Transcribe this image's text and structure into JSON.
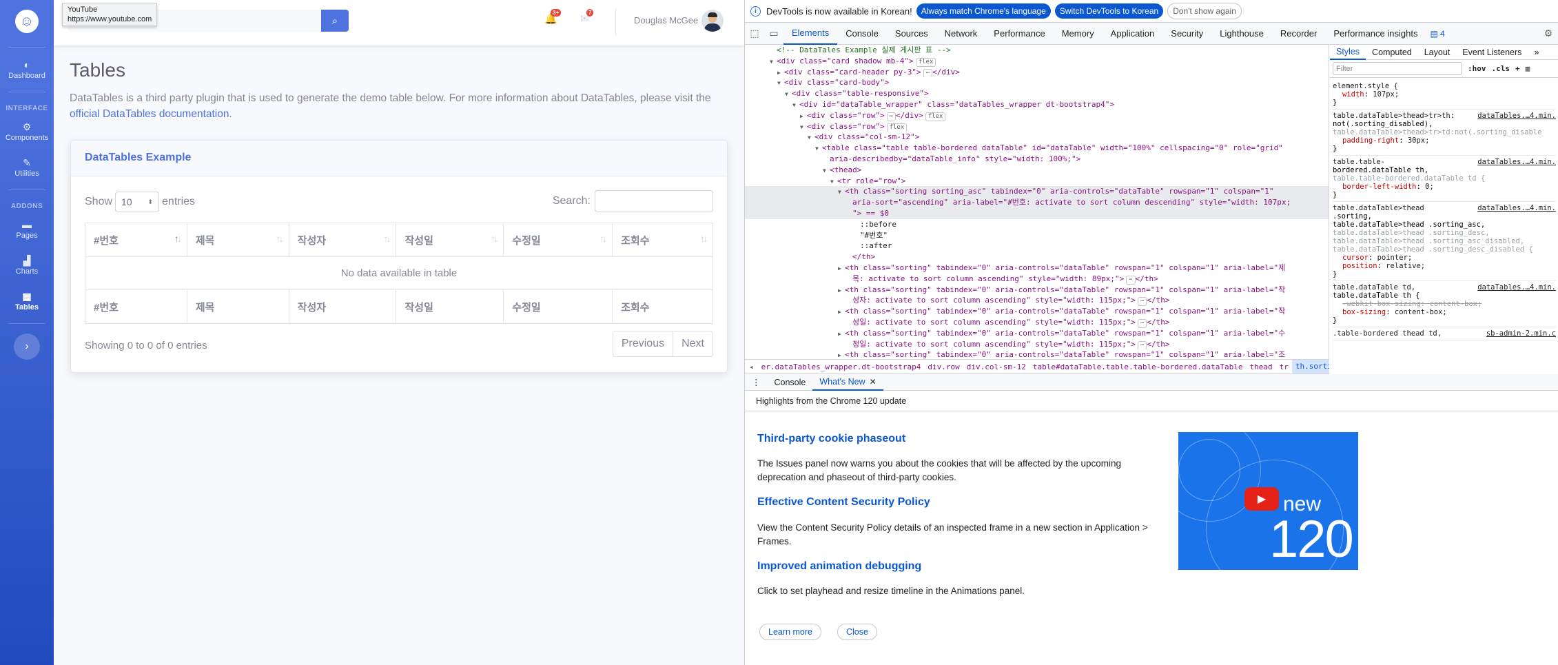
{
  "tooltip": {
    "title": "YouTube",
    "url": "https://www.youtube.com"
  },
  "sidebar": {
    "brand_glyph": "☺",
    "items": [
      {
        "label": "Dashboard",
        "icon": "tachometer-icon",
        "glyph": "◐"
      },
      {
        "label": "Components",
        "icon": "cog-icon",
        "glyph": "⚙"
      },
      {
        "label": "Utilities",
        "icon": "wrench-icon",
        "glyph": "✎"
      },
      {
        "label": "Pages",
        "icon": "folder-icon",
        "glyph": "▬"
      },
      {
        "label": "Charts",
        "icon": "chart-icon",
        "glyph": "▟"
      },
      {
        "label": "Tables",
        "icon": "table-icon",
        "glyph": "▦"
      }
    ],
    "headings": [
      "INTERFACE",
      "ADDONS"
    ],
    "toggle_glyph": "›"
  },
  "topbar": {
    "search_placeholder": "",
    "search_glyph": "⌕",
    "alerts_count": "3+",
    "alerts_glyph": "🔔",
    "messages_count": "7",
    "messages_glyph": "✉",
    "user_name": "Douglas McGee"
  },
  "main": {
    "title": "Tables",
    "desc_text": "DataTables is a third party plugin that is used to generate the demo table below. For more information about DataTables, please visit the ",
    "desc_link": "official DataTables documentation",
    "desc_end": "."
  },
  "card": {
    "title": "DataTables Example",
    "show_label": "Show",
    "length_value": "10",
    "entries_label": "entries",
    "search_label": "Search:",
    "columns": [
      "#번호",
      "제목",
      "작성자",
      "작성일",
      "수정일",
      "조회수"
    ],
    "empty_text": "No data available in table",
    "info": "Showing 0 to 0 of 0 entries",
    "prev": "Previous",
    "next": "Next"
  },
  "devtools": {
    "infobar": {
      "message": "DevTools is now available in Korean!",
      "btn_match": "Always match Chrome's language",
      "btn_switch": "Switch DevTools to Korean",
      "btn_dismiss": "Don't show again"
    },
    "tabs": [
      "Elements",
      "Console",
      "Sources",
      "Network",
      "Performance",
      "Memory",
      "Application",
      "Security",
      "Lighthouse",
      "Recorder",
      "Performance insights"
    ],
    "issues_count": "4",
    "dom": [
      {
        "i": 4,
        "t": "c",
        "c": "<!-- DataTales Example 실제 게시판 표 -->"
      },
      {
        "i": 4,
        "a": "▼",
        "h": "<div class=\"card shadow mb-4\">",
        "p": "flex"
      },
      {
        "i": 5,
        "a": "▶",
        "h": "<div class=\"card-header py-3\">",
        "e": "</div>",
        "dots": true
      },
      {
        "i": 5,
        "a": "▼",
        "h": "<div class=\"card-body\">"
      },
      {
        "i": 6,
        "a": "▼",
        "h": "<div class=\"table-responsive\">"
      },
      {
        "i": 7,
        "a": "▼",
        "h": "<div id=\"dataTable_wrapper\" class=\"dataTables_wrapper dt-bootstrap4\">"
      },
      {
        "i": 8,
        "a": "▶",
        "h": "<div class=\"row\">",
        "e": "</div>",
        "dots": true,
        "p": "flex"
      },
      {
        "i": 8,
        "a": "▼",
        "h": "<div class=\"row\">",
        "p": "flex"
      },
      {
        "i": 9,
        "a": "▼",
        "h": "<div class=\"col-sm-12\">"
      },
      {
        "i": 10,
        "a": "▼",
        "h": "<table class=\"table table-bordered dataTable\" id=\"dataTable\" width=\"100%\" cellspacing=\"0\" role=\"grid\""
      },
      {
        "i": 11,
        "a": "",
        "h": "aria-describedby=\"dataTable_info\" style=\"width: 100%;\">"
      },
      {
        "i": 11,
        "a": "▼",
        "h": "<thead>"
      },
      {
        "i": 12,
        "a": "▼",
        "h": "<tr role=\"row\">"
      },
      {
        "i": 13,
        "a": "▼",
        "h": "<th class=\"sorting sorting_asc\" tabindex=\"0\" aria-controls=\"dataTable\" rowspan=\"1\" colspan=\"1\"",
        "sel": true
      },
      {
        "i": 14,
        "a": "",
        "h": "aria-sort=\"ascending\" aria-label=\"#번호: activate to sort column descending\" style=\"width: 107px;",
        "sel": true
      },
      {
        "i": 14,
        "a": "",
        "h": "\"> == $0",
        "sel": true
      },
      {
        "i": 15,
        "t": "x",
        "c": "::before"
      },
      {
        "i": 15,
        "t": "x",
        "c": "\"#번호\""
      },
      {
        "i": 15,
        "t": "x",
        "c": "::after"
      },
      {
        "i": 14,
        "a": "",
        "h": "</th>"
      },
      {
        "i": 13,
        "a": "▶",
        "h": "<th class=\"sorting\" tabindex=\"0\" aria-controls=\"dataTable\" rowspan=\"1\" colspan=\"1\" aria-label=\"제"
      },
      {
        "i": 14,
        "a": "",
        "h": "목: activate to sort column ascending\" style=\"width: 89px;\">",
        "e": "</th>",
        "dots": true
      },
      {
        "i": 13,
        "a": "▶",
        "h": "<th class=\"sorting\" tabindex=\"0\" aria-controls=\"dataTable\" rowspan=\"1\" colspan=\"1\" aria-label=\"작"
      },
      {
        "i": 14,
        "a": "",
        "h": "성자: activate to sort column ascending\" style=\"width: 115px;\">",
        "e": "</th>",
        "dots": true
      },
      {
        "i": 13,
        "a": "▶",
        "h": "<th class=\"sorting\" tabindex=\"0\" aria-controls=\"dataTable\" rowspan=\"1\" colspan=\"1\" aria-label=\"작"
      },
      {
        "i": 14,
        "a": "",
        "h": "성일: activate to sort column ascending\" style=\"width: 115px;\">",
        "e": "</th>",
        "dots": true
      },
      {
        "i": 13,
        "a": "▶",
        "h": "<th class=\"sorting\" tabindex=\"0\" aria-controls=\"dataTable\" rowspan=\"1\" colspan=\"1\" aria-label=\"수"
      },
      {
        "i": 14,
        "a": "",
        "h": "정일: activate to sort column ascending\" style=\"width: 115px;\">",
        "e": "</th>",
        "dots": true
      },
      {
        "i": 13,
        "a": "▶",
        "h": "<th class=\"sorting\" tabindex=\"0\" aria-controls=\"dataTable\" rowspan=\"1\" colspan=\"1\" aria-label=\"조"
      }
    ],
    "crumbs": [
      "er.dataTables_wrapper.dt-bootstrap4",
      "div.row",
      "div.col-sm-12",
      "table#dataTable.table.table-bordered.dataTable",
      "thead",
      "tr",
      "th.sorting.sorting_asc"
    ],
    "styles_tabs": [
      "Styles",
      "Computed",
      "Layout",
      "Event Listeners"
    ],
    "filter_placeholder": "Filter",
    "hov": ":hov",
    "cls": ".cls",
    "rules": [
      {
        "sel": "element.style {",
        "src": "",
        "props": [
          {
            "n": "width",
            "v": "107px;"
          }
        ],
        "close": "}"
      },
      {
        "sel": "table.dataTable>thead>tr>th:",
        "src": "dataTables.…4.min.",
        "extra": [
          "not(.sorting_disabled),"
        ],
        "grey": [
          "table.dataTable>thead>tr>td:not(.sorting_disable"
        ],
        "props": [
          {
            "n": "padding-right",
            "v": "30px;"
          }
        ],
        "close": "}"
      },
      {
        "sel": "table.table-",
        "src": "dataTables.…4.min.",
        "extra": [
          "bordered.dataTable th,"
        ],
        "grey": [
          "table.table-bordered.dataTable td {"
        ],
        "props": [
          {
            "n": "border-left-width",
            "v": "0;"
          }
        ],
        "close": "}"
      },
      {
        "sel": "table.dataTable>thead",
        "src": "dataTables.…4.min.",
        "extra": [
          ".sorting,",
          "table.dataTable>thead .sorting_asc,"
        ],
        "grey": [
          "table.dataTable>thead .sorting_desc,",
          "table.dataTable>thead .sorting_asc_disabled,",
          "table.dataTable>thead .sorting_desc_disabled {"
        ],
        "props": [
          {
            "n": "cursor",
            "v": "pointer;"
          },
          {
            "n": "position",
            "v": "relative;"
          }
        ],
        "close": "}"
      },
      {
        "sel": "table.dataTable td,",
        "src": "dataTables.…4.min.",
        "extra": [
          "table.dataTable th {"
        ],
        "grey": [],
        "props": [
          {
            "n": "-webkit-box-sizing",
            "v": "content-box;",
            "strike": true
          },
          {
            "n": "box-sizing",
            "v": "content-box;"
          }
        ],
        "close": "}"
      },
      {
        "sel": ".table-bordered thead td,",
        "src": "sb-admin-2.min.c",
        "extra": [],
        "grey": [],
        "props": [],
        "close": ""
      }
    ],
    "drawer": {
      "tabs": [
        "Console",
        "What's New"
      ],
      "subtitle": "Highlights from the Chrome 120 update",
      "items": [
        {
          "h": "Third-party cookie phaseout",
          "p": "The Issues panel now warns you about the cookies that will be affected by the upcoming deprecation and phaseout of third-party cookies."
        },
        {
          "h": "Effective Content Security Policy",
          "p": "View the Content Security Policy details of an inspected frame in a new section in Application > Frames."
        },
        {
          "h": "Improved animation debugging",
          "p": "Click to set playhead and resize timeline in the Animations panel."
        }
      ],
      "learn_more": "Learn more",
      "close": "Close",
      "promo_new": "new",
      "promo_num": "120"
    }
  }
}
